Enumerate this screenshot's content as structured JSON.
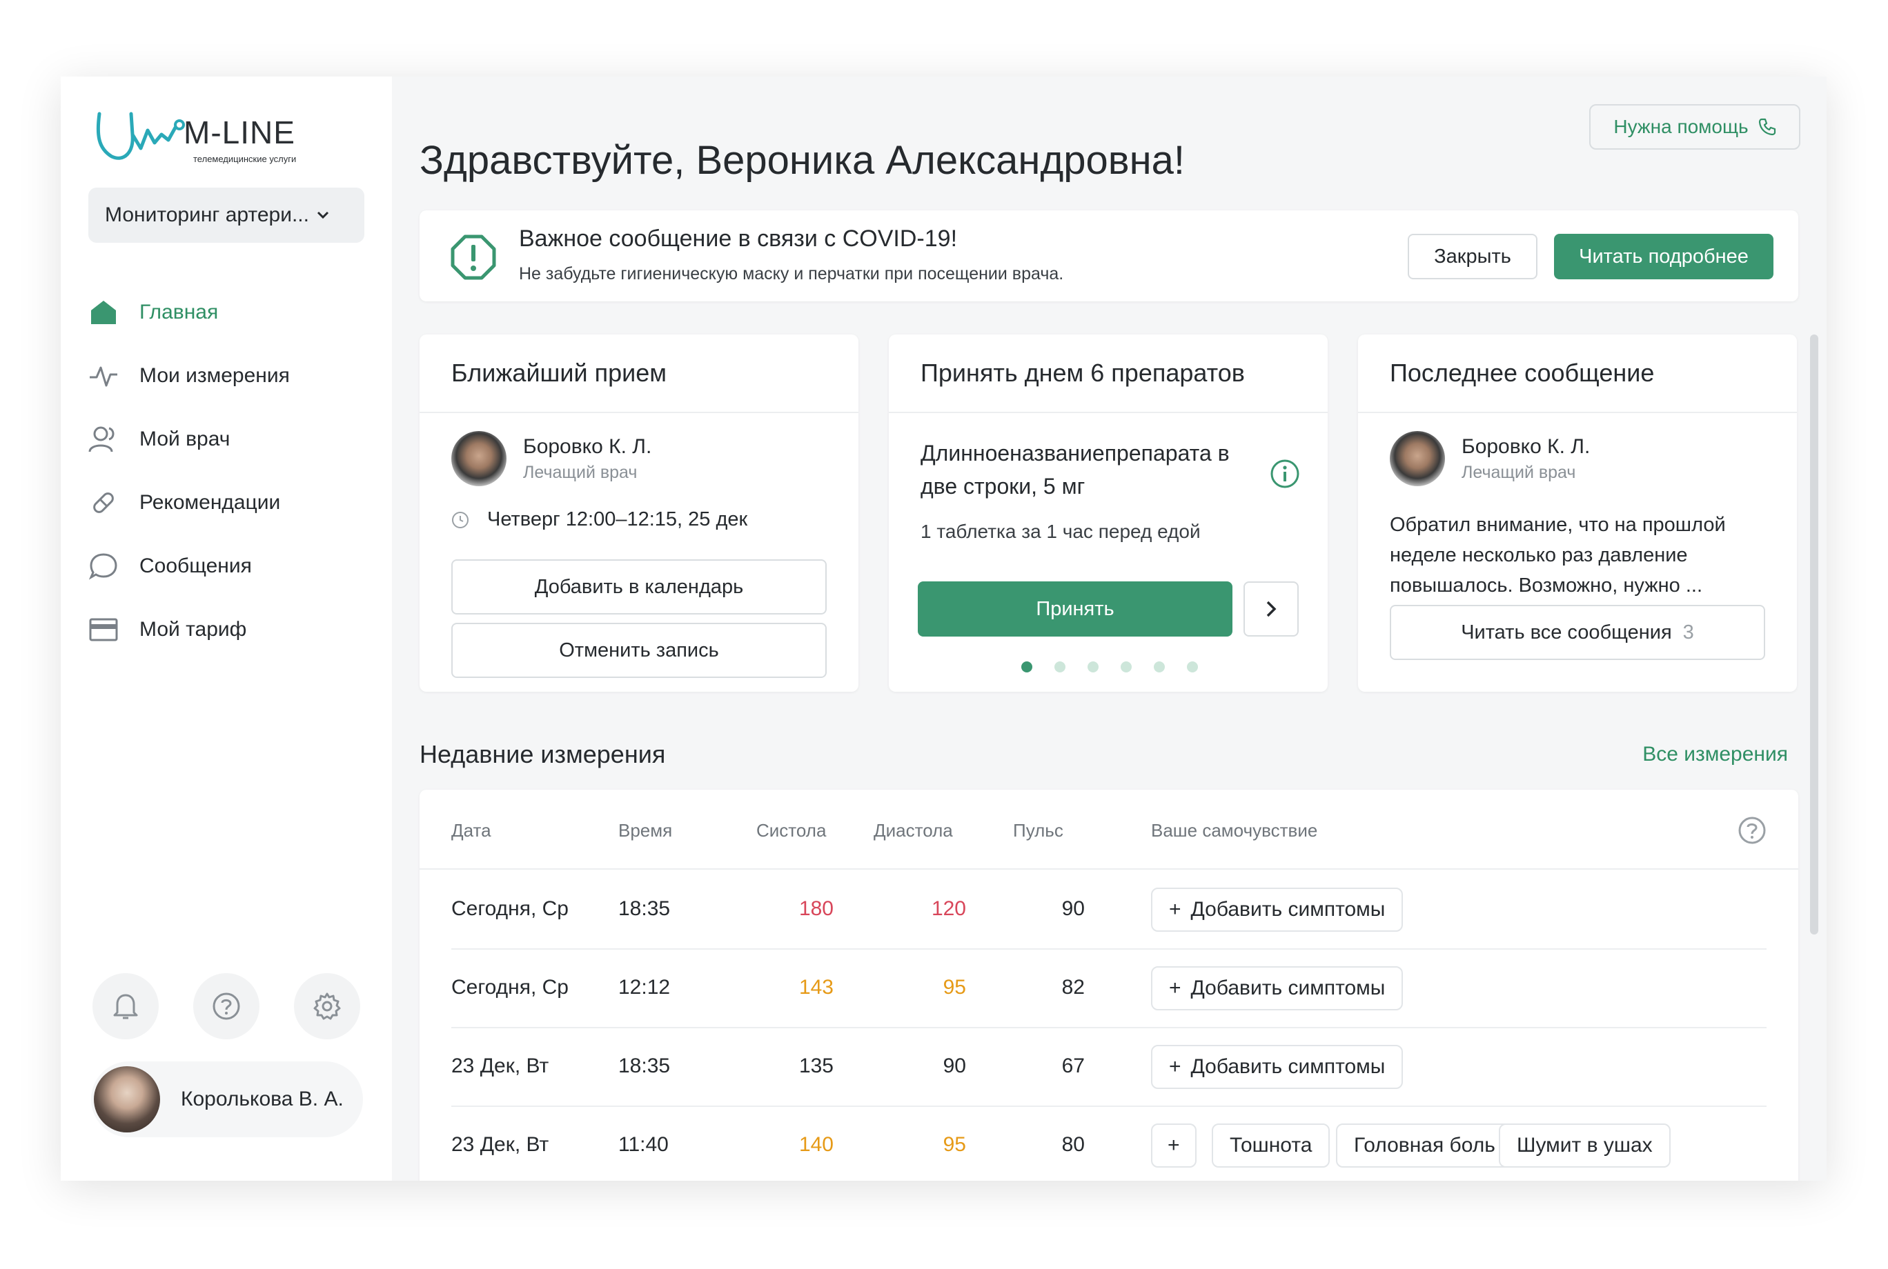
{
  "brand": {
    "name": "M-LINE",
    "tagline": "телемедицинские услуги"
  },
  "program_select": {
    "value": "Мониторинг артери..."
  },
  "nav": [
    {
      "label": "Главная",
      "icon": "home-icon",
      "active": true
    },
    {
      "label": "Мои измерения",
      "icon": "pulse-icon"
    },
    {
      "label": "Мой врач",
      "icon": "doctor-icon"
    },
    {
      "label": "Рекомендации",
      "icon": "pill-icon"
    },
    {
      "label": "Сообщения",
      "icon": "chat-icon"
    },
    {
      "label": "Мой тариф",
      "icon": "card-icon"
    }
  ],
  "user": {
    "name": "Королькова В. А."
  },
  "header": {
    "help_label": "Нужна помощь",
    "greeting": "Здравствуйте, Вероника Александровна!"
  },
  "alert": {
    "title": "Важное сообщение в связи с COVID-19!",
    "text": "Не забудьте гигиеническую маску и перчатки при посещении врача.",
    "close_label": "Закрыть",
    "more_label": "Читать подробнее"
  },
  "appointment": {
    "title": "Ближайший прием",
    "doctor_name": "Боровко К. Л.",
    "doctor_role": "Лечащий врач",
    "time": "Четверг 12:00–12:15, 25 дек",
    "add_calendar": "Добавить в календарь",
    "cancel": "Отменить запись"
  },
  "medication": {
    "title": "Принять днем 6 препаратов",
    "name": "Длинноеназваниепрепарата в две строки, 5 мг",
    "dose": "1 таблетка за 1 час перед едой",
    "take_label": "Принять",
    "pages": 6,
    "current_page": 1
  },
  "message": {
    "title": "Последнее сообщение",
    "doctor_name": "Боровко К. Л.",
    "doctor_role": "Лечащий врач",
    "text": "Обратил внимание, что на прошлой неделе несколько раз давление повышалось. Возможно, нужно ...",
    "read_all": "Читать все сообщения",
    "count": "3"
  },
  "measurements": {
    "title": "Недавние измерения",
    "all_link": "Все измерения",
    "columns": [
      "Дата",
      "Время",
      "Систола",
      "Диастола",
      "Пульс",
      "Ваше самочувствие"
    ],
    "rows": [
      {
        "date": "Сегодня, Ср",
        "time": "18:35",
        "sys": "180",
        "dia": "120",
        "pulse": "90",
        "level": "high",
        "symptoms": []
      },
      {
        "date": "Сегодня, Ср",
        "time": "12:12",
        "sys": "143",
        "dia": "95",
        "pulse": "82",
        "level": "elevated",
        "symptoms": []
      },
      {
        "date": "23 Дек, Вт",
        "time": "18:35",
        "sys": "135",
        "dia": "90",
        "pulse": "67",
        "level": "normal",
        "symptoms": []
      },
      {
        "date": "23 Дек, Вт",
        "time": "11:40",
        "sys": "140",
        "dia": "95",
        "pulse": "80",
        "level": "elevated",
        "symptoms": [
          "Тошнота",
          "Головная боль",
          "Шумит в ушах"
        ]
      }
    ],
    "add_symptoms": "Добавить симптомы",
    "plus": "+"
  },
  "colors": {
    "accent": "#3a9670",
    "high": "#d8465a",
    "elevated": "#e69a17"
  }
}
